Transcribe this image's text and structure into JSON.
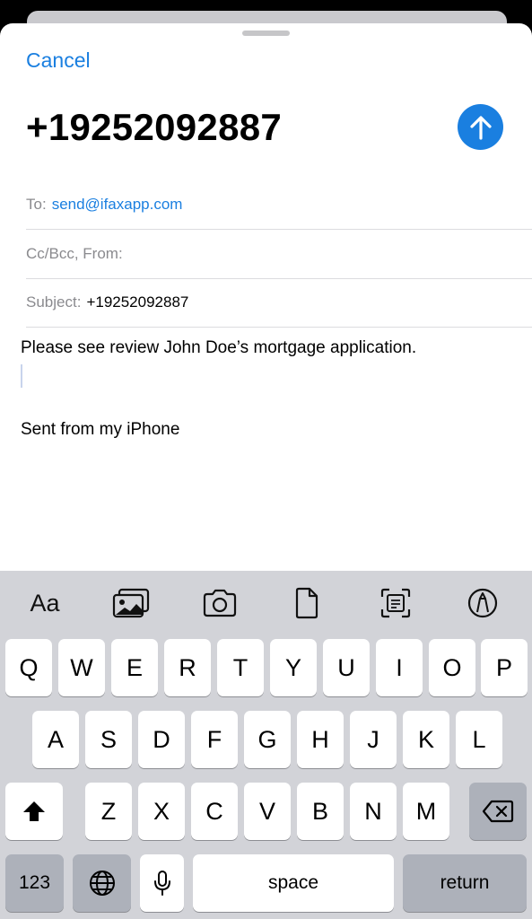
{
  "compose": {
    "cancel_label": "Cancel",
    "title": "+19252092887",
    "to_label": "To:",
    "to_value": "send@ifaxapp.com",
    "cc_label": "Cc/Bcc, From:",
    "subject_label": "Subject:",
    "subject_value": "+19252092887",
    "body": "Please see review John Doe’s mortgage application.",
    "signature": "Sent from my iPhone"
  },
  "keyboard": {
    "format_label": "Aa",
    "toolbar_icons": [
      "text-format-icon",
      "photo-library-icon",
      "camera-icon",
      "document-icon",
      "scan-document-icon",
      "markup-icon"
    ],
    "row1": [
      "Q",
      "W",
      "E",
      "R",
      "T",
      "Y",
      "U",
      "I",
      "O",
      "P"
    ],
    "row2": [
      "A",
      "S",
      "D",
      "F",
      "G",
      "H",
      "J",
      "K",
      "L"
    ],
    "row3": [
      "Z",
      "X",
      "C",
      "V",
      "B",
      "N",
      "M"
    ],
    "numbers_label": "123",
    "space_label": "space",
    "return_label": "return"
  },
  "colors": {
    "accent": "#1a7fe0",
    "keyboard_bg": "#d2d3d8",
    "key_dark": "#adb1ba"
  }
}
